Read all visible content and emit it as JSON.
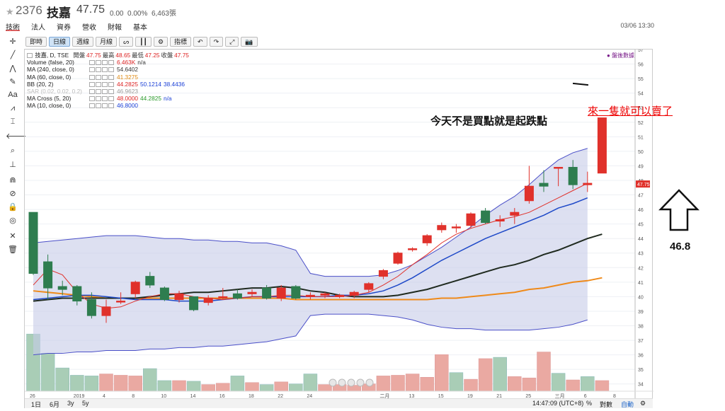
{
  "header": {
    "code": "2376",
    "name": "技嘉",
    "price": "47.75",
    "change": "0.00",
    "change_pct": "0.00%",
    "volume": "6,463張",
    "timestamp": "03/06 13:30"
  },
  "nav": [
    "技術",
    "法人",
    "資券",
    "營收",
    "財報",
    "基本"
  ],
  "toolbar": [
    "即時",
    "日線",
    "週線",
    "月線",
    "ᔕ",
    "┃┃",
    "⚙",
    "指標",
    "↶",
    "↷",
    "⤢",
    "📷"
  ],
  "sidebar_icons": [
    "crosshair-icon",
    "line-icon",
    "fork-icon",
    "brush-icon",
    "text-icon",
    "pattern-icon",
    "fib-icon",
    "arrow-left-icon",
    "zoom-icon",
    "measure-icon",
    "magnet-icon",
    "lock-draw-icon",
    "lock-icon",
    "eye-icon",
    "tools-icon",
    "trash-icon"
  ],
  "sidebar_glyphs": [
    "✛",
    "╱",
    "⋀",
    "✎",
    "Aa",
    "⩘",
    "⌶",
    "🡐",
    "⌕",
    "⊥",
    "⋒",
    "⊘",
    "🔒",
    "◎",
    "✕",
    "🗑"
  ],
  "legend": {
    "title": "技嘉, D, TSE",
    "ohlc_labels": [
      "開盤",
      "最高",
      "最低",
      "收盤"
    ],
    "ohlc_values": [
      "47.75",
      "48.65",
      "47.25",
      "47.75"
    ],
    "rows": [
      {
        "label": "Volume (false, 20)",
        "values": [
          {
            "t": "6.463K",
            "c": "red"
          },
          {
            "t": "n/a",
            "c": ""
          }
        ]
      },
      {
        "label": "MA (240, close, 0)",
        "values": [
          {
            "t": "54.6402",
            "c": ""
          }
        ]
      },
      {
        "label": "MA (60, close, 0)",
        "values": [
          {
            "t": "41.3275",
            "c": "orange"
          }
        ]
      },
      {
        "label": "BB (20, 2)",
        "values": [
          {
            "t": "44.2825",
            "c": "red"
          },
          {
            "t": "50.1214",
            "c": "blue"
          },
          {
            "t": "38.4436",
            "c": "blue"
          }
        ]
      },
      {
        "label": "SAR (0.02, 0.02, 0.2)",
        "values": [
          {
            "t": "46.9623",
            "c": "grey"
          }
        ],
        "muted": true
      },
      {
        "label": "MA Cross (5, 20)",
        "values": [
          {
            "t": "48.0000",
            "c": "red"
          },
          {
            "t": "44.2825",
            "c": "green"
          },
          {
            "t": "n/a",
            "c": "blue"
          }
        ]
      },
      {
        "label": "MA (10, close, 0)",
        "values": [
          {
            "t": "46.8000",
            "c": "blue"
          }
        ]
      }
    ]
  },
  "after_hours_label": "● 盤後數據",
  "annotations": {
    "mid": "今天不是買點就是起跌點",
    "red": "來一隻就可以賣了",
    "value": "46.8"
  },
  "bottom": {
    "ranges": [
      "1日",
      "6月",
      "3y",
      "5y"
    ],
    "clock": "14:47:09 (UTC+8)",
    "pct": "%",
    "log": "對數",
    "auto": "自動"
  },
  "colors": {
    "up": "#e0312b",
    "down": "#2e7d4f",
    "bb_fill": "#c7cbe8",
    "bb_line": "#4a4fc8",
    "ma60": "#ef8a1a",
    "ma20": "#1f2a1f",
    "ma10": "#1e49c8",
    "ma5": "#e0312b",
    "vol_up": "#eaa9a2",
    "vol_down": "#a9cdb6"
  },
  "chart_data": {
    "type": "candlestick",
    "ylim": [
      33.5,
      57
    ],
    "y_ticks": [
      34,
      35,
      36,
      37,
      38,
      39,
      40,
      41,
      42,
      43,
      44,
      45,
      46,
      47,
      48,
      49,
      50,
      51,
      52,
      53,
      54,
      55,
      56,
      57
    ],
    "x_tick_labels": [
      {
        "i": 0,
        "t": "26"
      },
      {
        "i": 3,
        "t": "2019"
      },
      {
        "i": 5,
        "t": "4"
      },
      {
        "i": 7,
        "t": "8"
      },
      {
        "i": 9,
        "t": "10"
      },
      {
        "i": 11,
        "t": "14"
      },
      {
        "i": 13,
        "t": "16"
      },
      {
        "i": 15,
        "t": "18"
      },
      {
        "i": 17,
        "t": "22"
      },
      {
        "i": 19,
        "t": "24"
      },
      {
        "i": 24,
        "t": "二月"
      },
      {
        "i": 26,
        "t": "13"
      },
      {
        "i": 28,
        "t": "15"
      },
      {
        "i": 30,
        "t": "19"
      },
      {
        "i": 32,
        "t": "21"
      },
      {
        "i": 34,
        "t": "25"
      },
      {
        "i": 36,
        "t": "三月"
      },
      {
        "i": 38,
        "t": "6"
      },
      {
        "i": 40,
        "t": "8"
      }
    ],
    "price_tag": "47.75",
    "candles": [
      {
        "o": 45.8,
        "h": 45.8,
        "l": 41.5,
        "c": 41.6
      },
      {
        "o": 42.4,
        "h": 42.9,
        "l": 39.8,
        "c": 40.6
      },
      {
        "o": 40.7,
        "h": 41.1,
        "l": 40.1,
        "c": 40.5
      },
      {
        "o": 40.7,
        "h": 40.8,
        "l": 39.4,
        "c": 39.7
      },
      {
        "o": 39.8,
        "h": 40.3,
        "l": 38.5,
        "c": 38.7
      },
      {
        "o": 38.7,
        "h": 39.8,
        "l": 38.2,
        "c": 39.3
      },
      {
        "o": 39.7,
        "h": 40.3,
        "l": 39.5,
        "c": 39.7
      },
      {
        "o": 40.2,
        "h": 41.1,
        "l": 39.9,
        "c": 41.0
      },
      {
        "o": 41.4,
        "h": 41.7,
        "l": 40.6,
        "c": 40.8
      },
      {
        "o": 40.6,
        "h": 40.7,
        "l": 39.7,
        "c": 39.8
      },
      {
        "o": 39.8,
        "h": 40.4,
        "l": 39.6,
        "c": 40.2
      },
      {
        "o": 40.0,
        "h": 40.0,
        "l": 39.0,
        "c": 39.1
      },
      {
        "o": 39.6,
        "h": 40.1,
        "l": 39.4,
        "c": 39.9
      },
      {
        "o": 40.0,
        "h": 40.6,
        "l": 39.8,
        "c": 40.0
      },
      {
        "o": 40.2,
        "h": 40.5,
        "l": 39.8,
        "c": 39.9
      },
      {
        "o": 40.2,
        "h": 40.5,
        "l": 40.0,
        "c": 40.3
      },
      {
        "o": 40.6,
        "h": 40.8,
        "l": 39.8,
        "c": 39.9
      },
      {
        "o": 39.9,
        "h": 40.8,
        "l": 39.7,
        "c": 40.6
      },
      {
        "o": 40.7,
        "h": 40.8,
        "l": 39.8,
        "c": 39.9
      },
      {
        "o": 40.0,
        "h": 40.3,
        "l": 39.8,
        "c": 40.1
      },
      {
        "o": 40.1,
        "h": 40.3,
        "l": 39.9,
        "c": 40.2
      },
      {
        "o": 40.0,
        "h": 40.2,
        "l": 39.9,
        "c": 40.1
      },
      {
        "o": 40.1,
        "h": 40.4,
        "l": 39.9,
        "c": 40.3
      },
      {
        "o": 40.5,
        "h": 41.0,
        "l": 40.3,
        "c": 40.9
      },
      {
        "o": 41.4,
        "h": 41.9,
        "l": 41.2,
        "c": 41.8
      },
      {
        "o": 42.3,
        "h": 43.1,
        "l": 42.2,
        "c": 43.0
      },
      {
        "o": 43.3,
        "h": 43.4,
        "l": 43.1,
        "c": 43.3
      },
      {
        "o": 43.7,
        "h": 44.3,
        "l": 43.5,
        "c": 44.2
      },
      {
        "o": 44.6,
        "h": 45.1,
        "l": 44.4,
        "c": 44.9
      },
      {
        "o": 44.8,
        "h": 45.0,
        "l": 44.4,
        "c": 44.8
      },
      {
        "o": 44.9,
        "h": 45.8,
        "l": 44.7,
        "c": 45.7
      },
      {
        "o": 45.9,
        "h": 46.1,
        "l": 45.0,
        "c": 45.1
      },
      {
        "o": 45.2,
        "h": 45.6,
        "l": 44.8,
        "c": 45.3
      },
      {
        "o": 45.6,
        "h": 46.1,
        "l": 45.0,
        "c": 45.8
      },
      {
        "o": 46.6,
        "h": 49.0,
        "l": 46.4,
        "c": 47.6
      },
      {
        "o": 47.8,
        "h": 48.7,
        "l": 47.2,
        "c": 47.6
      },
      {
        "o": 48.9,
        "h": 48.9,
        "l": 47.6,
        "c": 48.9
      },
      {
        "o": 48.9,
        "h": 49.4,
        "l": 47.4,
        "c": 47.7
      },
      {
        "o": 47.7,
        "h": 48.6,
        "l": 47.2,
        "c": 47.8
      },
      {
        "o": 48.5,
        "h": 52.3,
        "l": 48.5,
        "c": 52.3,
        "hypothetical": true
      }
    ],
    "hypothetical_index": 39,
    "volume": [
      {
        "v": 8.6,
        "u": false
      },
      {
        "v": 5.7,
        "u": false
      },
      {
        "v": 3.5,
        "u": false
      },
      {
        "v": 2.4,
        "u": false
      },
      {
        "v": 2.3,
        "u": false
      },
      {
        "v": 2.6,
        "u": true
      },
      {
        "v": 2.4,
        "u": true
      },
      {
        "v": 2.3,
        "u": true
      },
      {
        "v": 3.4,
        "u": false
      },
      {
        "v": 1.6,
        "u": false
      },
      {
        "v": 1.6,
        "u": true
      },
      {
        "v": 1.5,
        "u": false
      },
      {
        "v": 1.0,
        "u": true
      },
      {
        "v": 1.2,
        "u": true
      },
      {
        "v": 2.3,
        "u": false
      },
      {
        "v": 1.3,
        "u": true
      },
      {
        "v": 1.0,
        "u": false
      },
      {
        "v": 1.4,
        "u": true
      },
      {
        "v": 1.1,
        "u": false
      },
      {
        "v": 2.6,
        "u": false
      },
      {
        "v": 1.0,
        "u": true
      },
      {
        "v": 1.0,
        "u": true
      },
      {
        "v": 0.9,
        "u": true
      },
      {
        "v": 1.1,
        "u": true
      },
      {
        "v": 2.3,
        "u": true
      },
      {
        "v": 2.4,
        "u": true
      },
      {
        "v": 2.6,
        "u": true
      },
      {
        "v": 2.1,
        "u": true
      },
      {
        "v": 5.5,
        "u": true
      },
      {
        "v": 2.8,
        "u": false
      },
      {
        "v": 1.8,
        "u": true
      },
      {
        "v": 4.9,
        "u": true
      },
      {
        "v": 5.1,
        "u": false
      },
      {
        "v": 2.2,
        "u": true
      },
      {
        "v": 2.0,
        "u": true
      },
      {
        "v": 5.9,
        "u": true
      },
      {
        "v": 2.7,
        "u": false
      },
      {
        "v": 1.7,
        "u": true
      },
      {
        "v": 2.2,
        "u": false
      },
      {
        "v": 1.6,
        "u": true
      }
    ],
    "bb_upper": [
      43.7,
      43.8,
      43.9,
      44.0,
      44.1,
      44.2,
      44.2,
      44.2,
      44.1,
      44.0,
      44.0,
      43.9,
      43.9,
      43.8,
      43.8,
      43.7,
      43.7,
      43.5,
      43.2,
      41.6,
      41.4,
      41.4,
      41.4,
      41.4,
      41.5,
      41.8,
      42.2,
      42.8,
      43.4,
      44.1,
      44.8,
      45.6,
      46.3,
      46.9,
      47.7,
      48.6,
      49.4,
      49.9,
      50.2
    ],
    "bb_lower": [
      36.0,
      36.1,
      36.1,
      36.2,
      36.2,
      36.3,
      36.3,
      36.3,
      36.4,
      36.4,
      36.5,
      36.5,
      36.6,
      36.6,
      36.7,
      36.8,
      36.9,
      37.1,
      37.3,
      38.7,
      38.8,
      38.8,
      38.8,
      38.8,
      38.7,
      38.6,
      38.4,
      38.1,
      37.9,
      37.8,
      37.8,
      37.7,
      37.7,
      37.7,
      37.7,
      37.8,
      37.9,
      38.1,
      38.4
    ],
    "ma60": [
      40.4,
      40.3,
      40.2,
      40.1,
      40.0,
      39.9,
      39.9,
      39.9,
      39.9,
      39.9,
      39.9,
      39.9,
      39.9,
      39.9,
      39.9,
      39.9,
      39.9,
      39.9,
      39.8,
      39.8,
      39.8,
      39.8,
      39.8,
      39.8,
      39.8,
      39.8,
      39.8,
      39.8,
      39.9,
      39.9,
      40.0,
      40.1,
      40.2,
      40.3,
      40.5,
      40.6,
      40.8,
      41.0,
      41.1,
      41.3
    ],
    "ma20": [
      39.7,
      39.8,
      39.9,
      39.9,
      39.9,
      39.9,
      39.9,
      39.9,
      40.0,
      40.1,
      40.2,
      40.3,
      40.3,
      40.4,
      40.5,
      40.6,
      40.6,
      40.7,
      40.6,
      40.4,
      40.3,
      40.1,
      40.0,
      40.0,
      40.0,
      40.1,
      40.3,
      40.5,
      40.8,
      41.1,
      41.4,
      41.7,
      42.0,
      42.2,
      42.5,
      42.9,
      43.2,
      43.6,
      44.0,
      44.3
    ],
    "ma10": [
      39.8,
      39.9,
      40.0,
      40.1,
      40.1,
      40.0,
      39.9,
      39.8,
      39.8,
      39.8,
      39.7,
      39.7,
      39.7,
      39.8,
      39.9,
      40.0,
      40.0,
      40.0,
      40.0,
      40.0,
      40.0,
      40.1,
      40.1,
      40.2,
      40.4,
      40.8,
      41.3,
      41.9,
      42.5,
      43.0,
      43.5,
      44.0,
      44.4,
      44.8,
      45.2,
      45.6,
      46.1,
      46.4,
      46.8
    ],
    "ma5": [
      40.8,
      41.9,
      41.5,
      40.3,
      39.5,
      39.2,
      39.3,
      39.7,
      40.0,
      40.2,
      40.2,
      40.0,
      39.9,
      39.8,
      39.9,
      40.0,
      40.0,
      40.1,
      40.1,
      40.0,
      40.0,
      40.0,
      40.1,
      40.3,
      40.8,
      41.4,
      42.2,
      42.9,
      43.7,
      44.3,
      44.7,
      45.0,
      45.3,
      45.5,
      45.8,
      46.3,
      46.8,
      47.3,
      47.8
    ]
  }
}
